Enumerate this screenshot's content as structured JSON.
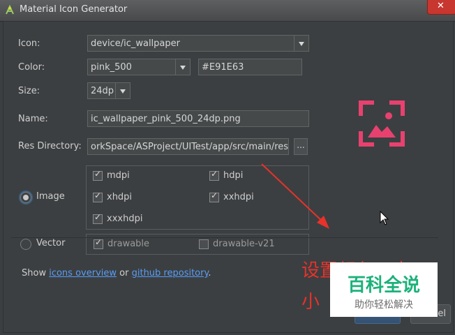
{
  "window": {
    "title": "Material Icon Generator"
  },
  "form": {
    "icon_label": "Icon:",
    "icon_value": "device/ic_wallpaper",
    "color_label": "Color:",
    "color_value": "pink_500",
    "color_hex": "#E91E63",
    "size_label": "Size:",
    "size_value": "24dp",
    "name_label": "Name:",
    "name_value": "ic_wallpaper_pink_500_24dp.png",
    "resdir_label": "Res Directory:",
    "resdir_value": "orkSpace/ASProject/UITest/app/src/main/res",
    "browse_label": "..."
  },
  "modes": {
    "image_label": "Image",
    "image_selected": true,
    "vector_label": "Vector",
    "vector_selected": false
  },
  "densities": [
    {
      "label": "mdpi",
      "checked": true
    },
    {
      "label": "hdpi",
      "checked": true
    },
    {
      "label": "xhdpi",
      "checked": true
    },
    {
      "label": "xxhdpi",
      "checked": true
    },
    {
      "label": "xxxhdpi",
      "checked": true
    }
  ],
  "vector_options": [
    {
      "label": "drawable",
      "checked": true
    },
    {
      "label": "drawable-v21",
      "checked": false
    }
  ],
  "footer": {
    "show_text": "Show",
    "icons_overview_link": "icons overview",
    "or_text": "or",
    "github_link": "github repository",
    "period": ".",
    "cancel_fragment": "cel"
  },
  "annotation": {
    "line1": "设置颜色、大",
    "line2": "小"
  },
  "watermark": {
    "title": "百科全说",
    "subtitle": "助你轻松解决"
  },
  "colors": {
    "icon_preview": "#e8416f",
    "link": "#589df6",
    "annotation": "#e8322a",
    "watermark_green": "#1bb27a"
  },
  "icons": {
    "app": "android-studio-icon",
    "preview": "wallpaper-icon",
    "close": "close-icon"
  }
}
